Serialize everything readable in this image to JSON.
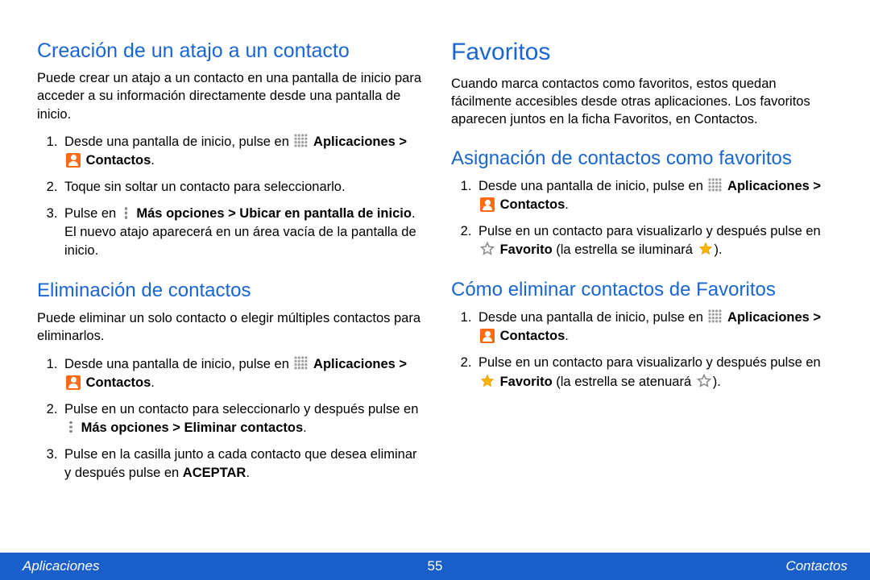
{
  "left": {
    "s1_title": "Creación de un atajo a un contacto",
    "s1_intro": "Puede crear un atajo a un contacto en una pantalla de inicio para acceder a su información directamente desde una pantalla de inicio.",
    "s1_li1_a": "Desde una pantalla de inicio, pulse en ",
    "s1_li1_b_bold": "Aplicaciones > ",
    "s1_li1_c_bold": " Contactos",
    "s1_li1_d": ".",
    "s1_li2": "Toque sin soltar un contacto para seleccionarlo.",
    "s1_li3_a": "Pulse en ",
    "s1_li3_b_bold": " Más opciones > Ubicar en pantalla de inicio",
    "s1_li3_c": ". El nuevo atajo aparecerá en un área vacía de la pantalla de inicio.",
    "s2_title": "Eliminación de contactos",
    "s2_intro": "Puede eliminar un solo contacto o elegir múltiples contactos para eliminarlos.",
    "s2_li1_a": "Desde una pantalla de inicio, pulse en ",
    "s2_li1_b_bold": "Aplicaciones > ",
    "s2_li1_c_bold": " Contactos",
    "s2_li1_d": ".",
    "s2_li2_a": "Pulse en un contacto para seleccionarlo y después pulse en ",
    "s2_li2_b_bold": " Más opciones > Eliminar contactos",
    "s2_li2_c": ".",
    "s2_li3_a": "Pulse en la casilla junto a cada contacto que desea eliminar y después pulse en ",
    "s2_li3_b_bold": "ACEPTAR",
    "s2_li3_c": "."
  },
  "right": {
    "s3_title": "Favoritos",
    "s3_intro": "Cuando marca contactos como favoritos, estos quedan fácilmente accesibles desde otras aplicaciones. Los favoritos aparecen juntos en la ficha Favoritos, en Contactos.",
    "s4_title": "Asignación de contactos como favoritos",
    "s4_li1_a": "Desde una pantalla de inicio, pulse en ",
    "s4_li1_b_bold": "Aplicaciones > ",
    "s4_li1_c_bold": " Contactos",
    "s4_li1_d": ".",
    "s4_li2_a": "Pulse en un contacto para visualizarlo y después pulse en ",
    "s4_li2_b_bold": " Favorito",
    "s4_li2_c": " (la estrella se iluminará ",
    "s4_li2_d": ").",
    "s5_title": "Cómo eliminar contactos de Favoritos",
    "s5_li1_a": "Desde una pantalla de inicio, pulse en ",
    "s5_li1_b_bold": "Aplicaciones > ",
    "s5_li1_c_bold": " Contactos",
    "s5_li1_d": ".",
    "s5_li2_a": "Pulse en un contacto para visualizarlo y después pulse en ",
    "s5_li2_b_bold": " Favorito",
    "s5_li2_c": " (la estrella se atenuará ",
    "s5_li2_d": ")."
  },
  "footer": {
    "left": "Aplicaciones",
    "page": "55",
    "right": "Contactos"
  }
}
